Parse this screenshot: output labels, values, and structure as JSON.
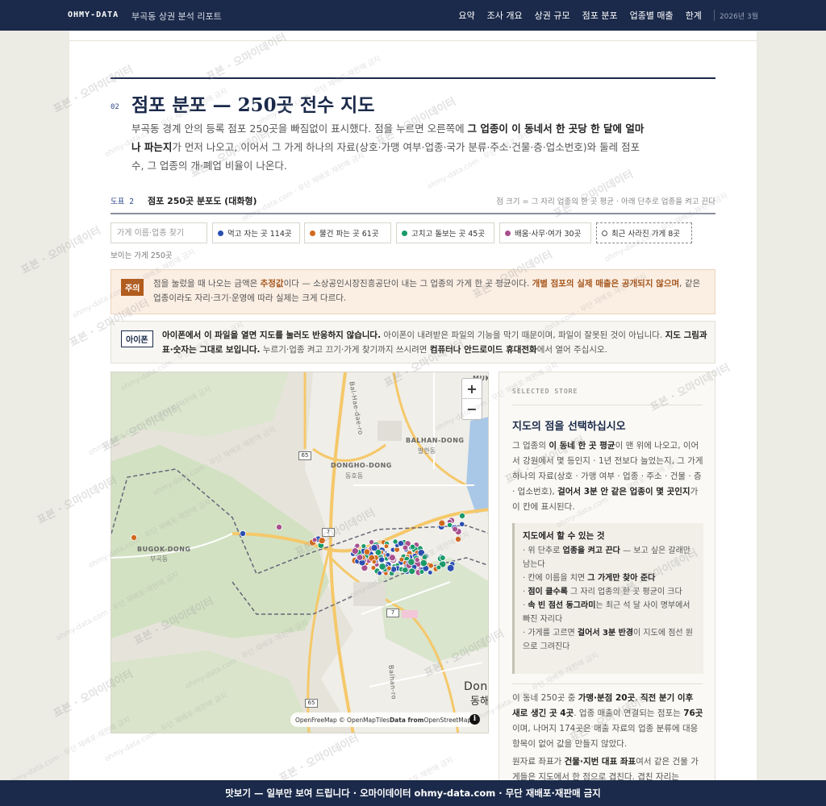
{
  "header": {
    "brand": "OHMY-DATA",
    "subtitle": "부곡동 상권 분석 리포트",
    "nav": [
      "요약",
      "조사 개요",
      "상권 규모",
      "점포 분포",
      "업종별 매출",
      "한계"
    ],
    "date": "2026년 3월"
  },
  "section": {
    "number": "02",
    "title": "점포 분포 — 250곳 전수 지도",
    "intro_a": "부곡동 경계 안의 등록 점포 250곳을 빠짐없이 표시했다. 점을 누르면 오른쪽에 ",
    "intro_b": "그 업종이 이 동네서 한 곳당 한 달에 얼마나 파는지",
    "intro_c": "가 먼저 나오고, 이어서 그 가게 하나의 자료(상호·가맹 여부·업종·국가 분류·주소·건물·층·업소번호)와 둘레 점포 수, 그 업종의 개·폐업 비율이 나온다."
  },
  "figure": {
    "label": "도표 2",
    "title": "점포 250곳 분포도 (대화형)",
    "note": "점 크기 = 그 자리 업종의 한 곳 평균 · 아래 단추로 업종을 켜고 끈다"
  },
  "filters": {
    "search_placeholder": "가게 이름·업종 찾기",
    "chips": [
      {
        "label": "먹고 자는 곳 114곳",
        "color": "#2b4fb0"
      },
      {
        "label": "물건 파는 곳 61곳",
        "color": "#d06a1e"
      },
      {
        "label": "고치고 돌보는 곳 45곳",
        "color": "#1a9a6a"
      },
      {
        "label": "배움·사무·여가 30곳",
        "color": "#a8508e"
      }
    ],
    "closed_chip": "최근 사라진 가게 8곳",
    "visible_count": "보이는 가게 250곳"
  },
  "caution": {
    "tag": "주의",
    "t1": "점을 눌렀을 때 나오는 금액은 ",
    "t2": "추정값",
    "t3": "이다 — 소상공인시장진흥공단이 내는 그 업종의 가게 한 곳 평균이다. ",
    "t4": "개별 점포의 실제 매출은 공개되지 않으며",
    "t5": ", 같은 업종이라도 자리·크기·운영에 따라 실제는 크게 다르다."
  },
  "appnote": {
    "tag": "아이폰",
    "t1": "아이폰에서 이 파일을 열면 지도를 눌러도 반응하지 않습니다.",
    "t2": " 아이폰이 내려받은 파일의 기능을 막기 때문이며, 파일이 잘못된 것이 아닙니다. ",
    "t3": "지도 그림과 표·숫자는 그대로 보입니다.",
    "t4": " 누르기·업종 켜고 끄기·가게 찾기까지 쓰시려면 ",
    "t5": "컴퓨터나 안드로이드 휴대전화",
    "t6": "에서 열어 주십시오."
  },
  "map": {
    "zoom_in": "+",
    "zoom_out": "−",
    "attribution_a": "OpenFreeMap © OpenMapTiles ",
    "attribution_b": "Data from",
    "attribution_c": " OpenStreetMap",
    "info": "i",
    "places": {
      "balhan_en": "BALHAN-DONG",
      "balhan_ko": "발한동",
      "dongho_en": "DONGHO-DONG",
      "dongho_ko": "동호동",
      "bugok_en": "BUGOK-DONG",
      "bugok_ko": "부곡동",
      "dong_en": "Dong",
      "dong_ko": "동해",
      "muk": "MUK",
      "road1": "Bal-Hae-dae-ro",
      "road2": "Balhan-ro"
    },
    "routes": [
      "65",
      "7",
      "7",
      "65"
    ]
  },
  "panel": {
    "kicker": "SELECTED STORE",
    "title": "지도의 점을 선택하십시오",
    "p1a": "그 업종의 ",
    "p1b": "이 동네 한 곳 평균",
    "p1c": "이 맨 위에 나오고, 이어서 강원에서 몇 등인지 · 1년 전보다 늘었는지, 그 가게 하나의 자료(상호 · 가맹 여부 · 업종 · 주소 · 건물 · 층 · 업소번호), ",
    "p1d": "걸어서 3분 안 같은 업종이 몇 곳인지",
    "p1e": "가 이 칸에 표시된다.",
    "howto_title": "지도에서 할 수 있는 것",
    "h1a": "· 위 단추로 ",
    "h1b": "업종을 켜고 끈다",
    "h1c": " — 보고 싶은 갈래만 남는다",
    "h2a": "· 칸에 이름을 치면 ",
    "h2b": "그 가게만 찾아 준다",
    "h3a": "· ",
    "h3b": "점이 클수록",
    "h3c": " 그 자리 업종의 한 곳 평균이 크다",
    "h4a": "· ",
    "h4b": "속 빈 점선 동그라미",
    "h4c": "는 최근 석 달 사이 명부에서 빠진 자리다",
    "h5a": "· 가게를 고르면 ",
    "h5b": "걸어서 3분 반경",
    "h5c": "이 지도에 점선 원으로 그려진다",
    "p2a": "이 동네 250곳 중 ",
    "p2b": "가맹·분점 20곳",
    "p2c": ", ",
    "p2d": "직전 분기 이후 새로 생긴 곳 4곳",
    "p2e": ". 업종 매출이 연결되는 점포는 ",
    "p2f": "76곳",
    "p2g": "이며, 나머지 174곳은 매출 자료의 업종 분류에 대응 항목이 없어 값을 만들지 않았다.",
    "p3a": "원자료 좌표가 ",
    "p3b": "건물·지번 대표 좌표",
    "p3c": "여서 같은 건물 가게들은 지도에서 한 점으로 겹친다. 겹친 자리는"
  },
  "banner": "맛보기 — 일부만 보여 드립니다 · 오마이데이터 ohmy-data.com · 무단 재배포·재판매 금지",
  "watermark": {
    "big": "표본 · 오마이데이터",
    "small": "ohmy-data.com · 무단 재배포·재판매 금지"
  },
  "colors": {
    "navy": "#1b2a4a",
    "food": "#2b4fb0",
    "retail": "#d06a1e",
    "service": "#1a9a6a",
    "edu": "#a8508e",
    "caution": "#b25c1e"
  }
}
